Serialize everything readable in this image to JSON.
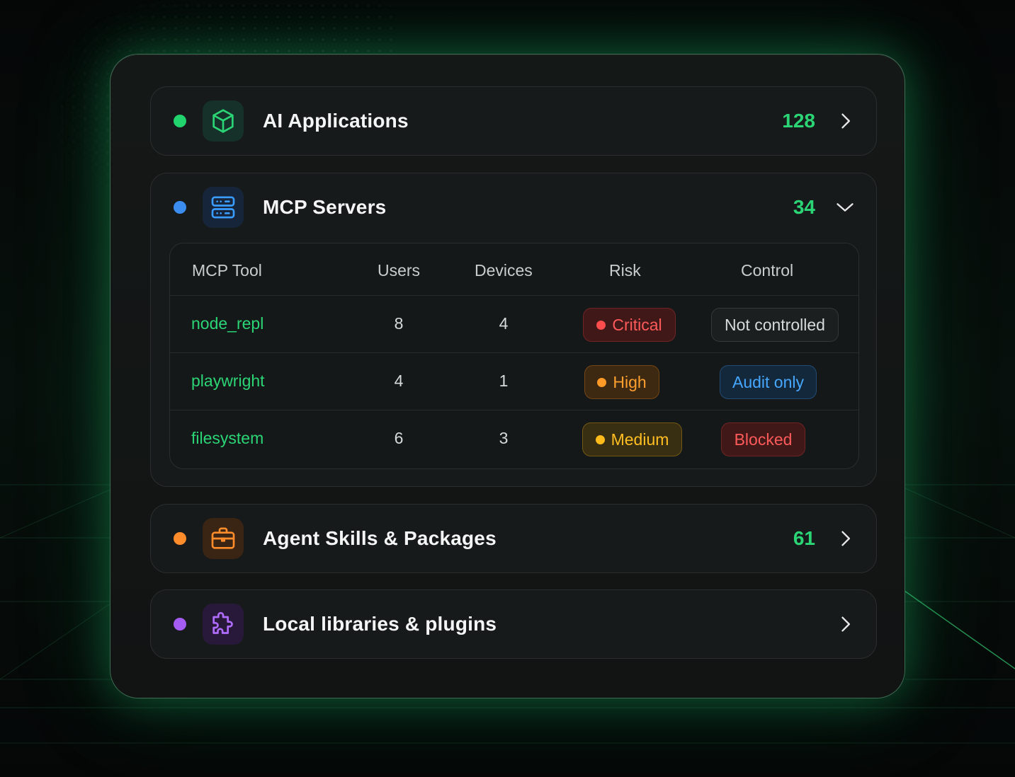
{
  "colors": {
    "accent_green": "#2bd576",
    "dot_green": "#22d46e",
    "dot_blue": "#3b8ef0",
    "dot_orange": "#ff8c2a",
    "dot_purple": "#a45cf2"
  },
  "categories": [
    {
      "title": "AI Applications",
      "count": "128",
      "icon": "cube-icon",
      "dot_color": "green",
      "state": "collapsed"
    },
    {
      "title": "MCP Servers",
      "count": "34",
      "icon": "server-icon",
      "dot_color": "blue",
      "state": "expanded"
    },
    {
      "title": "Agent Skills & Packages",
      "count": "61",
      "icon": "briefcase-icon",
      "dot_color": "orange",
      "state": "collapsed"
    },
    {
      "title": "Local libraries & plugins",
      "count": "",
      "icon": "puzzle-icon",
      "dot_color": "purple",
      "state": "collapsed"
    }
  ],
  "mcp_table": {
    "columns": [
      "MCP Tool",
      "Users",
      "Devices",
      "Risk",
      "Control"
    ],
    "rows": [
      {
        "tool": "node_repl",
        "users": "8",
        "devices": "4",
        "risk": "Critical",
        "control": "Not controlled"
      },
      {
        "tool": "playwright",
        "users": "4",
        "devices": "1",
        "risk": "High",
        "control": "Audit only"
      },
      {
        "tool": "filesystem",
        "users": "6",
        "devices": "3",
        "risk": "Medium",
        "control": "Blocked"
      }
    ]
  }
}
